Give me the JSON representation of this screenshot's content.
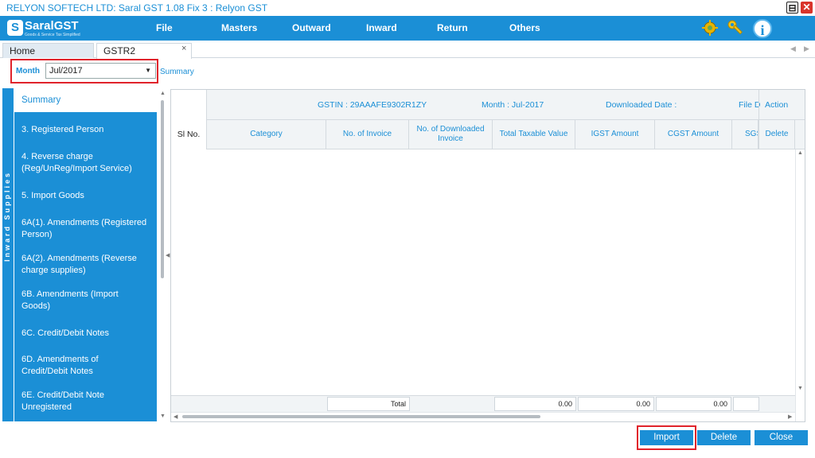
{
  "window": {
    "title": "RELYON SOFTECH LTD: Saral GST  1.08 Fix 3 : Relyon GST",
    "minimize_glyph": "⊟",
    "close_glyph": "✕"
  },
  "logo": {
    "mark": "S",
    "name": "SaralGST",
    "tagline": "Goods & Service Tax Simplified"
  },
  "menu": {
    "items": [
      {
        "label": "File"
      },
      {
        "label": "Masters"
      },
      {
        "label": "Outward"
      },
      {
        "label": "Inward"
      },
      {
        "label": "Return"
      },
      {
        "label": "Others"
      }
    ]
  },
  "toolbar_icons": {
    "settings": "gear-icon",
    "keys": "key-icon",
    "info": "i"
  },
  "tabs": [
    {
      "label": "Home"
    },
    {
      "label": "GSTR2",
      "close": "×"
    }
  ],
  "filter": {
    "month_label": "Month",
    "month_value": "Jul/2017",
    "summary_link": "Summary"
  },
  "sidebar": {
    "vertical_label": "Inward Supplies",
    "items": [
      {
        "label": "Summary"
      },
      {
        "label": "3. Registered Person"
      },
      {
        "label": "4. Reverse charge (Reg/UnReg/Import Service)"
      },
      {
        "label": "5. Import Goods"
      },
      {
        "label": "6A(1). Amendments (Registered Person)"
      },
      {
        "label": "6A(2). Amendments (Reverse charge supplies)"
      },
      {
        "label": "6B. Amendments (Import Goods)"
      },
      {
        "label": "6C. Credit/Debit Notes"
      },
      {
        "label": "6D. Amendments of Credit/Debit Notes"
      },
      {
        "label": "6E. Credit/Debit Note Unregistered"
      }
    ]
  },
  "grid": {
    "info": {
      "gstin": "GSTIN : 29AAAFE9302R1ZY",
      "month": "Month : Jul-2017",
      "downloaded": "Downloaded Date :",
      "file": "File D",
      "action": "Action"
    },
    "columns": {
      "slno": "Sl No.",
      "category": "Category",
      "no_invoice": "No. of Invoice",
      "no_downloaded": "No. of Downloaded Invoice",
      "taxable": "Total Taxable Value",
      "igst": "IGST Amount",
      "cgst": "CGST Amount",
      "sgst": "SGS",
      "delete": "Delete"
    },
    "totals": {
      "label": "Total",
      "taxable": "0.00",
      "igst": "0.00",
      "cgst": "0.00"
    }
  },
  "buttons": {
    "import": "Import",
    "delete": "Delete",
    "close": "Close"
  },
  "colors": {
    "accent": "#1b8fd6",
    "highlight": "#e0232b"
  }
}
